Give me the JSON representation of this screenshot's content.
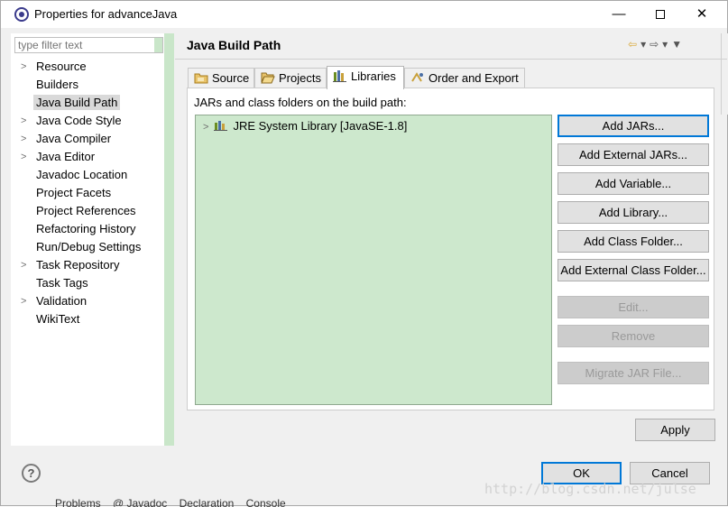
{
  "window": {
    "title": "Properties for advanceJava",
    "minimize": "—",
    "close": "✕"
  },
  "filter": {
    "placeholder": "type filter text"
  },
  "tree": [
    {
      "label": "Resource",
      "expandable": true
    },
    {
      "label": "Builders",
      "expandable": false
    },
    {
      "label": "Java Build Path",
      "expandable": false,
      "selected": true
    },
    {
      "label": "Java Code Style",
      "expandable": true
    },
    {
      "label": "Java Compiler",
      "expandable": true
    },
    {
      "label": "Java Editor",
      "expandable": true
    },
    {
      "label": "Javadoc Location",
      "expandable": false
    },
    {
      "label": "Project Facets",
      "expandable": false
    },
    {
      "label": "Project References",
      "expandable": false
    },
    {
      "label": "Refactoring History",
      "expandable": false
    },
    {
      "label": "Run/Debug Settings",
      "expandable": false
    },
    {
      "label": "Task Repository",
      "expandable": true
    },
    {
      "label": "Task Tags",
      "expandable": false
    },
    {
      "label": "Validation",
      "expandable": true
    },
    {
      "label": "WikiText",
      "expandable": false
    }
  ],
  "page": {
    "title": "Java Build Path"
  },
  "tabs": [
    {
      "label": "Source",
      "icon": "folder-source-icon"
    },
    {
      "label": "Projects",
      "icon": "folder-open-icon"
    },
    {
      "label": "Libraries",
      "icon": "library-icon",
      "active": true
    },
    {
      "label": "Order and Export",
      "icon": "order-export-icon"
    }
  ],
  "libraries": {
    "label": "JARs and class folders on the build path:",
    "items": [
      {
        "label": "JRE System Library [JavaSE-1.8]"
      }
    ]
  },
  "buttons": {
    "add_jars": "Add JARs...",
    "add_external_jars": "Add External JARs...",
    "add_variable": "Add Variable...",
    "add_library": "Add Library...",
    "add_class_folder": "Add Class Folder...",
    "add_external_class_folder": "Add External Class Folder...",
    "edit": "Edit...",
    "remove": "Remove",
    "migrate_jar": "Migrate JAR File...",
    "apply": "Apply",
    "ok": "OK",
    "cancel": "Cancel"
  },
  "help": "?",
  "bottom_tabs": [
    "Problems",
    "@ Javadoc",
    "Declaration",
    "Console"
  ],
  "watermark": "http://blog.csdn.net/julse",
  "colors": {
    "selection_green": "#cde8cd",
    "primary_border": "#0078d7"
  }
}
